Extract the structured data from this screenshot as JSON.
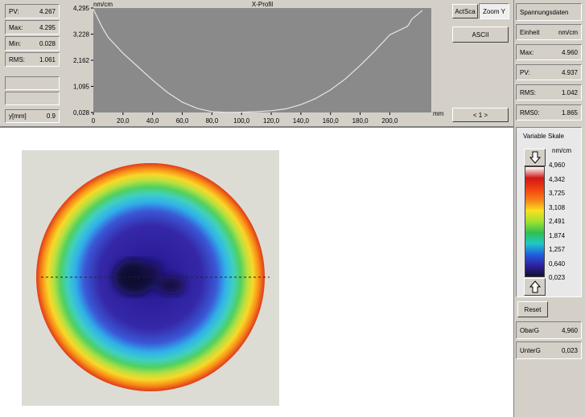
{
  "stats_left": {
    "rows": [
      {
        "label": "PV:",
        "value": "4.267"
      },
      {
        "label": "Max:",
        "value": "4.295"
      },
      {
        "label": "Min:",
        "value": "0.028"
      },
      {
        "label": "RMS:",
        "value": "1.061"
      }
    ],
    "y_label": "y[mm]",
    "y_value": "0.9"
  },
  "profile": {
    "title": "X-Profil",
    "y_unit": "nm/cm",
    "x_unit": "mm",
    "y_ticks": [
      "4,295",
      "3,228",
      "2,162",
      "1,095",
      "0,028"
    ],
    "x_ticks": [
      "0",
      "20,0",
      "40,0",
      "60,0",
      "80,0",
      "100,0",
      "120,0",
      "140,0",
      "160,0",
      "180,0",
      "200,0"
    ]
  },
  "chart_data": {
    "type": "line",
    "title": "X-Profil",
    "xlabel": "mm",
    "ylabel": "nm/cm",
    "x": [
      0,
      2,
      6,
      10,
      20,
      30,
      40,
      50,
      60,
      70,
      80,
      90,
      100,
      110,
      120,
      130,
      140,
      150,
      160,
      170,
      180,
      190,
      200,
      212,
      215,
      220,
      222
    ],
    "y": [
      4.25,
      4.0,
      3.5,
      3.1,
      2.45,
      1.9,
      1.35,
      0.85,
      0.45,
      0.2,
      0.06,
      0.03,
      0.04,
      0.06,
      0.1,
      0.18,
      0.35,
      0.6,
      0.95,
      1.4,
      1.95,
      2.55,
      3.2,
      3.55,
      3.85,
      4.1,
      4.2
    ],
    "xlim": [
      0,
      228
    ],
    "ylim": [
      0.028,
      4.295
    ]
  },
  "top_buttons": {
    "actsca": "ActSca",
    "zoom": "Zoom Y",
    "ascii": "ASCII",
    "nav": "< 1 >"
  },
  "right_panel": {
    "title": "Spannungsdaten",
    "unit_label": "Einheit",
    "unit_value": "nm/cm",
    "rows": [
      {
        "label": "Max:",
        "value": "4.960"
      },
      {
        "label": "PV:",
        "value": "4.937"
      },
      {
        "label": "RMS:",
        "value": "1.042"
      },
      {
        "label": "RMS0:",
        "value": "1.865"
      }
    ]
  },
  "scale": {
    "title": "Variable Skale",
    "unit": "nm/cm",
    "ticks": [
      "4,960",
      "4,342",
      "3,725",
      "3,108",
      "2,491",
      "1,874",
      "1,257",
      "0,640",
      "0,023"
    ],
    "colors": [
      "#ffffff",
      "#d01818",
      "#f04010",
      "#f88018",
      "#f8e020",
      "#a0e030",
      "#30c050",
      "#20c8c8",
      "#2060e0",
      "#3020a0",
      "#101030"
    ]
  },
  "bottom_right": {
    "reset": "Reset",
    "oberg_label": "ObarG",
    "oberg_value": "4,960",
    "unterg_label": "UnterG",
    "unterg_value": "0,023"
  }
}
